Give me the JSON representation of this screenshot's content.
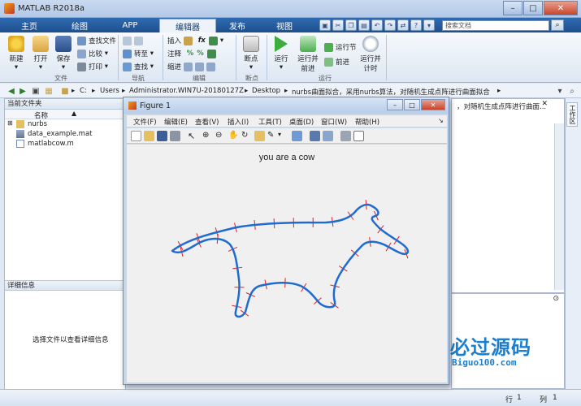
{
  "window": {
    "title": "MATLAB R2018a",
    "min": "–",
    "max": "□",
    "close": "✕"
  },
  "tabs": [
    {
      "label": "主页"
    },
    {
      "label": "绘图"
    },
    {
      "label": "APP"
    },
    {
      "label": "编辑器"
    },
    {
      "label": "发布"
    },
    {
      "label": "视图"
    }
  ],
  "search": {
    "placeholder": "搜索文档"
  },
  "ribbon": {
    "new": "新建",
    "open": "打开",
    "save": "保存",
    "find_files": "查找文件",
    "compare": "比较",
    "print": "打印",
    "goto": "转至",
    "find": "查找",
    "insert": "插入",
    "comment": "注释",
    "indent": "缩进",
    "breakpoints": "断点",
    "run": "运行",
    "run_advance": "运行并\n前进",
    "run_section": "运行节",
    "advance": "前进",
    "run_time": "运行并\n计时",
    "groups": {
      "file": "文件",
      "navigate": "导航",
      "edit": "编辑",
      "breakpoints": "断点",
      "run": "运行"
    }
  },
  "address": {
    "parts": [
      "C:",
      "Users",
      "Administrator.WIN7U-20180127Z",
      "Desktop",
      "nurbs曲面拟合，采用nurbs算法，对随机生成点阵进行曲面拟合"
    ],
    "behind_figure": "，对随机生成点阵进行曲面..."
  },
  "left_panel": {
    "title": "当前文件夹",
    "column": "名称",
    "files": [
      {
        "name": "nurbs"
      },
      {
        "name": "data_example.mat"
      },
      {
        "name": "matlabcow.m"
      }
    ],
    "details_title": "详细信息",
    "details_text": "选择文件以查看详细信息"
  },
  "workspace": "工作区",
  "status": {
    "row_label": "行",
    "row": "1",
    "col_label": "列",
    "col": "1"
  },
  "figure": {
    "title": "Figure 1",
    "menu": [
      "文件(F)",
      "编辑(E)",
      "查看(V)",
      "插入(I)",
      "工具(T)",
      "桌面(D)",
      "窗口(W)",
      "帮助(H)"
    ],
    "plot_title": "you are a cow"
  },
  "logo": {
    "cn": "必过源码",
    "en": "Biguo100.com"
  },
  "colors": {
    "curve": "#1f6bd1",
    "normals": "#e02020",
    "tab_bar": "#2f6bb1"
  }
}
